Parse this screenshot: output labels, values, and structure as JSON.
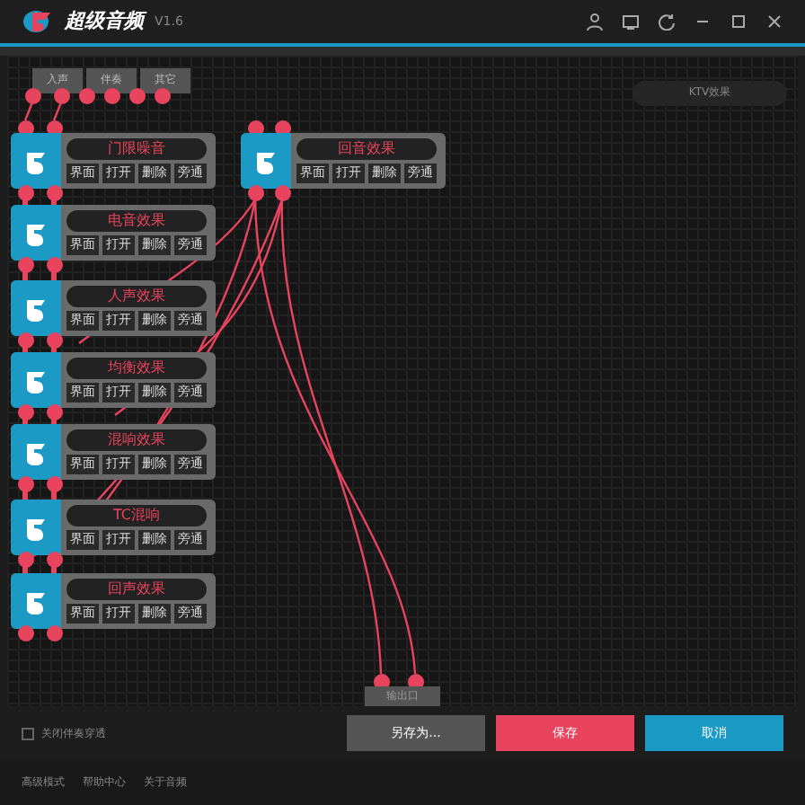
{
  "window": {
    "title": "超级音频",
    "version": "V1.6"
  },
  "inputs": [
    "入声",
    "伴奏",
    "其它"
  ],
  "preset": "KTV效果",
  "left_nodes": [
    {
      "name": "门限噪音",
      "buttons": [
        "界面",
        "打开",
        "删除",
        "旁通"
      ]
    },
    {
      "name": "电音效果",
      "buttons": [
        "界面",
        "打开",
        "删除",
        "旁通"
      ]
    },
    {
      "name": "人声效果",
      "buttons": [
        "界面",
        "打开",
        "删除",
        "旁通"
      ]
    },
    {
      "name": "均衡效果",
      "buttons": [
        "界面",
        "打开",
        "删除",
        "旁通"
      ]
    },
    {
      "name": "混响效果",
      "buttons": [
        "界面",
        "打开",
        "删除",
        "旁通"
      ]
    },
    {
      "name": "TC混响",
      "buttons": [
        "界面",
        "打开",
        "删除",
        "旁通"
      ]
    },
    {
      "name": "回声效果",
      "buttons": [
        "界面",
        "打开",
        "删除",
        "旁通"
      ]
    }
  ],
  "right_node": {
    "name": "回音效果",
    "buttons": [
      "界面",
      "打开",
      "删除",
      "旁通"
    ]
  },
  "output": "输出口",
  "bypass_option": {
    "label": "关闭伴奏穿透",
    "checked": false
  },
  "actions": [
    "另存为...",
    "保存",
    "取消"
  ],
  "footer_links": [
    "高级模式",
    "帮助中心",
    "关于音频"
  ]
}
